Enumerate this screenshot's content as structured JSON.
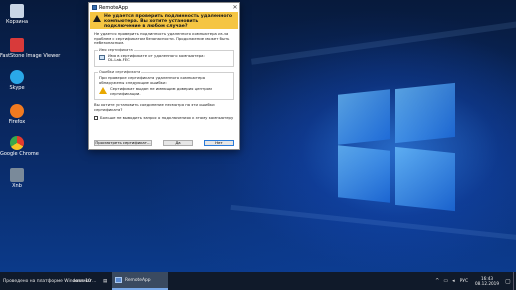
{
  "desktop": {
    "icons": [
      {
        "name": "recycle-bin",
        "label": "Корзина",
        "color": "#c9d6e6"
      },
      {
        "name": "faststone",
        "label": "FastStone Image Viewer",
        "color": "#d83a3a"
      },
      {
        "name": "skype",
        "label": "Skype",
        "color": "#2aa8e8"
      },
      {
        "name": "firefox",
        "label": "Firefox",
        "color": "#f07a20"
      },
      {
        "name": "chrome",
        "label": "Google Chrome",
        "color": "#3aa84a"
      },
      {
        "name": "xnview",
        "label": "Xnb",
        "color": "#7a8a9a"
      }
    ]
  },
  "dialog": {
    "title": "RemoteApp",
    "header": "Не удается проверить подлинность удаленного компьютера. Вы хотите установить подключение в любом случае?",
    "intro": "Не удается проверить подлинность удаленного компьютера из-за проблем с сертификатом безопасности. Продолжение может быть небезопасным.",
    "cert_name_group": "Имя сертификата",
    "cert_name_label": "Имя в сертификате от удаленного компьютера:",
    "cert_name_value": "DL-Lab-FEC",
    "errors_group": "Ошибки сертификата",
    "errors_intro": "При проверке сертификата удаленного компьютера обнаружены следующие ошибки:",
    "error_1": "Сертификат выдан не имеющим доверия центром сертификации.",
    "question": "Вы хотите установить соединение несмотря на эти ошибки сертификата?",
    "dont_ask": "Больше не выводить запрос о подключениях к этому компьютеру",
    "view_cert_button": "Просмотреть сертификат...",
    "yes_button": "Да",
    "no_button": "Нет"
  },
  "taskbar": {
    "left_text": "Проведено на платформе Windows 10",
    "mid_text": "автомат...",
    "active_app": "RemoteApp",
    "lang": "РУС",
    "time": "16:43",
    "date": "08.12.2019"
  },
  "colors": {
    "warning_banner": "#f5c542",
    "primary_button_border": "#2a7ad8"
  }
}
